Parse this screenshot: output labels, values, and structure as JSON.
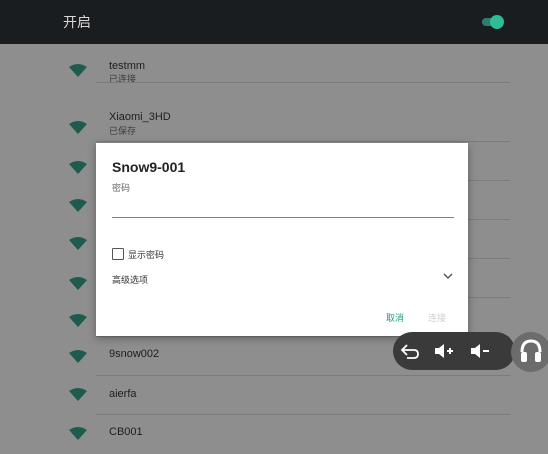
{
  "header": {
    "title": "开启",
    "toggle_on": true,
    "accent_color": "#2dbd96"
  },
  "wifi_list": [
    {
      "name": "testmm",
      "status": "已连接"
    },
    {
      "name": "Xiaomi_3HD",
      "status": "已保存"
    },
    {
      "name": "",
      "status": ""
    },
    {
      "name": "",
      "status": ""
    },
    {
      "name": "",
      "status": ""
    },
    {
      "name": "",
      "status": ""
    },
    {
      "name": "",
      "status": ""
    },
    {
      "name": "9snow002",
      "status": ""
    },
    {
      "name": "aierfa",
      "status": ""
    },
    {
      "name": "CB001",
      "status": ""
    }
  ],
  "dialog": {
    "title": "Snow9-001",
    "password_label": "密码",
    "password_value": "",
    "show_password_label": "显示密码",
    "show_password_checked": false,
    "advanced_options_label": "高级选项",
    "cancel_label": "取消",
    "connect_label": "连接"
  },
  "nav": {
    "icons": [
      "back-icon",
      "volume-up-icon",
      "volume-down-icon",
      "hearing-icon"
    ]
  }
}
